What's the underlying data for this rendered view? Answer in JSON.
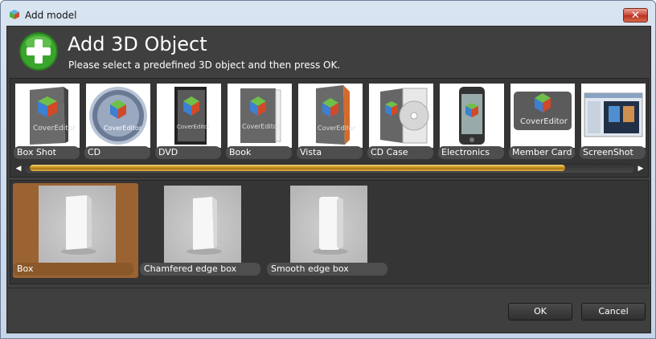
{
  "window": {
    "title": "Add model",
    "close_label": "✕"
  },
  "header": {
    "title": "Add 3D Object",
    "subtitle": "Please select a predefined 3D object and then press OK."
  },
  "models": [
    {
      "label": "Box Shot",
      "icon": "box-shot-icon"
    },
    {
      "label": "CD",
      "icon": "cd-icon"
    },
    {
      "label": "DVD",
      "icon": "dvd-icon"
    },
    {
      "label": "Book",
      "icon": "book-icon"
    },
    {
      "label": "Vista",
      "icon": "vista-box-icon"
    },
    {
      "label": "CD Case",
      "icon": "cd-case-icon"
    },
    {
      "label": "Electronics",
      "icon": "electronics-icon"
    },
    {
      "label": "Member Card",
      "icon": "member-card-icon"
    },
    {
      "label": "ScreenShot",
      "icon": "screenshot-icon"
    }
  ],
  "thumb_brand_text": "CoverEditor",
  "scrollbar": {
    "left_arrow": "◀",
    "right_arrow": "▶"
  },
  "variants": [
    {
      "label": "Box",
      "selected": true
    },
    {
      "label": "Chamfered edge box",
      "selected": false
    },
    {
      "label": "Smooth edge box",
      "selected": false
    }
  ],
  "buttons": {
    "ok": "OK",
    "cancel": "Cancel"
  },
  "colors": {
    "accent_orange": "#9b6232",
    "scroll_gold": "#c8921a",
    "dialog_bg": "#3f3f3f",
    "add_green": "#3aa52c"
  }
}
